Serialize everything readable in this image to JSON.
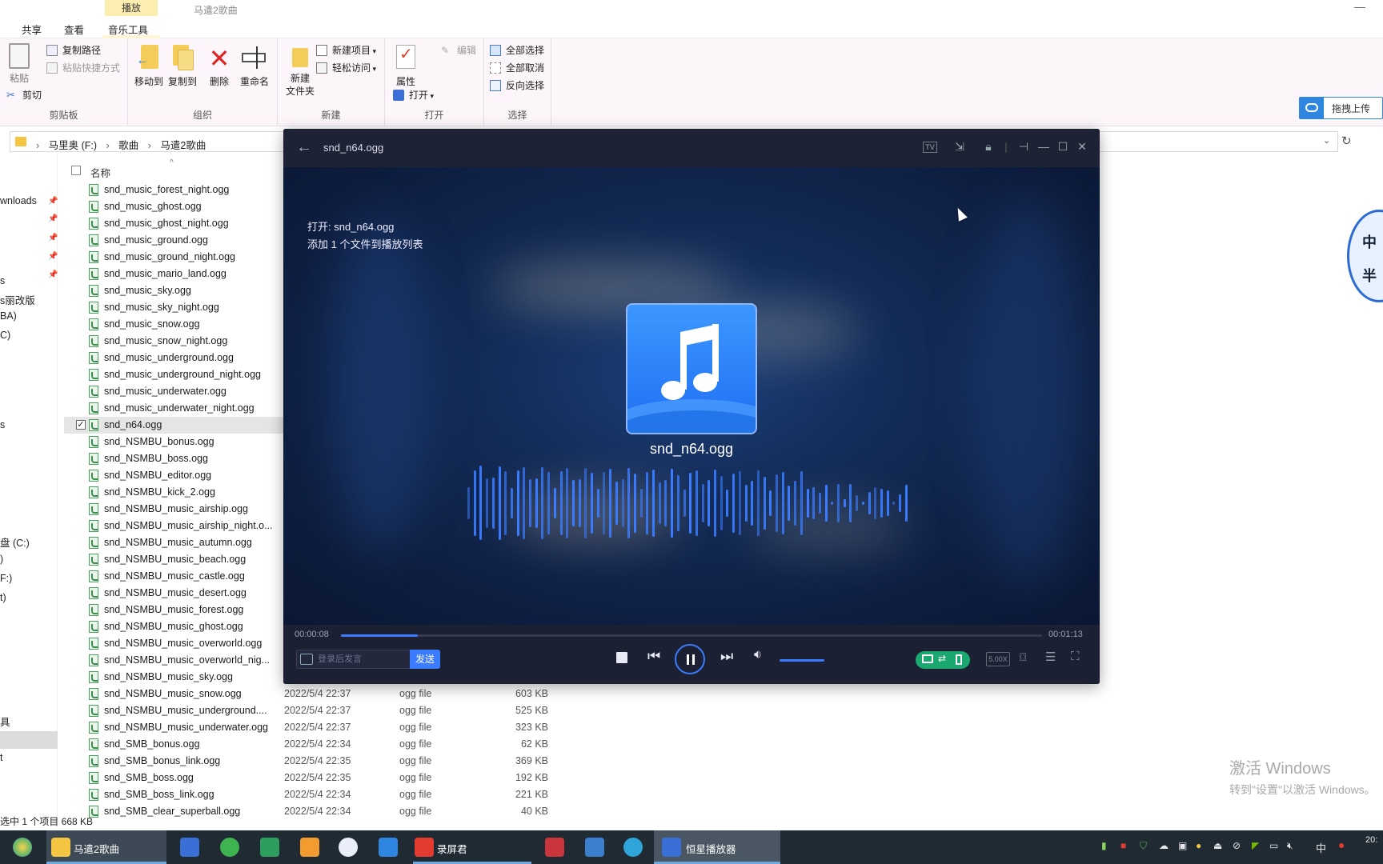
{
  "explorer": {
    "title": "马遣2歌曲",
    "context_tab": "播放",
    "tabs": [
      "共享",
      "查看",
      "音乐工具"
    ],
    "ribbon": {
      "clipboard": {
        "paste": "粘贴",
        "copy_path": "复制路径",
        "paste_shortcut": "粘贴快捷方式",
        "cut": "剪切",
        "label": "剪贴板"
      },
      "organize": {
        "move_to": "移动到",
        "copy_to": "复制到",
        "delete": "删除",
        "rename": "重命名",
        "label": "组织"
      },
      "new": {
        "new_folder_1": "新建",
        "new_folder_2": "文件夹",
        "new_item": "新建项目",
        "easy_access": "轻松访问",
        "label": "新建"
      },
      "open": {
        "properties": "属性",
        "open": "打开",
        "edit": "编辑",
        "label": "打开"
      },
      "select": {
        "select_all": "全部选择",
        "select_none": "全部取消",
        "invert": "反向选择",
        "label": "选择"
      },
      "upload": "拖拽上传"
    },
    "breadcrumb": [
      "马里奥 (F:)",
      "歌曲",
      "马遣2歌曲"
    ],
    "left_panel": [
      "wnloads",
      "s",
      "s丽改版",
      "BA)",
      "C)",
      "s",
      "盘 (C:)",
      ")",
      "F:)",
      "t)",
      "具",
      "t"
    ],
    "column_name": "名称",
    "files": [
      {
        "name": "snd_music_forest_night.ogg",
        "date": "",
        "type": "",
        "size": ""
      },
      {
        "name": "snd_music_ghost.ogg",
        "date": "",
        "type": "",
        "size": ""
      },
      {
        "name": "snd_music_ghost_night.ogg",
        "date": "",
        "type": "",
        "size": ""
      },
      {
        "name": "snd_music_ground.ogg",
        "date": "",
        "type": "",
        "size": ""
      },
      {
        "name": "snd_music_ground_night.ogg",
        "date": "",
        "type": "",
        "size": ""
      },
      {
        "name": "snd_music_mario_land.ogg",
        "date": "",
        "type": "",
        "size": ""
      },
      {
        "name": "snd_music_sky.ogg",
        "date": "",
        "type": "",
        "size": ""
      },
      {
        "name": "snd_music_sky_night.ogg",
        "date": "",
        "type": "",
        "size": ""
      },
      {
        "name": "snd_music_snow.ogg",
        "date": "",
        "type": "",
        "size": ""
      },
      {
        "name": "snd_music_snow_night.ogg",
        "date": "",
        "type": "",
        "size": ""
      },
      {
        "name": "snd_music_underground.ogg",
        "date": "",
        "type": "",
        "size": ""
      },
      {
        "name": "snd_music_underground_night.ogg",
        "date": "",
        "type": "",
        "size": ""
      },
      {
        "name": "snd_music_underwater.ogg",
        "date": "",
        "type": "",
        "size": ""
      },
      {
        "name": "snd_music_underwater_night.ogg",
        "date": "",
        "type": "",
        "size": ""
      },
      {
        "name": "snd_n64.ogg",
        "date": "",
        "type": "",
        "size": "",
        "selected": true
      },
      {
        "name": "snd_NSMBU_bonus.ogg",
        "date": "",
        "type": "",
        "size": ""
      },
      {
        "name": "snd_NSMBU_boss.ogg",
        "date": "",
        "type": "",
        "size": ""
      },
      {
        "name": "snd_NSMBU_editor.ogg",
        "date": "",
        "type": "",
        "size": ""
      },
      {
        "name": "snd_NSMBU_kick_2.ogg",
        "date": "",
        "type": "",
        "size": ""
      },
      {
        "name": "snd_NSMBU_music_airship.ogg",
        "date": "",
        "type": "",
        "size": ""
      },
      {
        "name": "snd_NSMBU_music_airship_night.o...",
        "date": "",
        "type": "",
        "size": ""
      },
      {
        "name": "snd_NSMBU_music_autumn.ogg",
        "date": "",
        "type": "",
        "size": ""
      },
      {
        "name": "snd_NSMBU_music_beach.ogg",
        "date": "",
        "type": "",
        "size": ""
      },
      {
        "name": "snd_NSMBU_music_castle.ogg",
        "date": "",
        "type": "",
        "size": ""
      },
      {
        "name": "snd_NSMBU_music_desert.ogg",
        "date": "",
        "type": "",
        "size": ""
      },
      {
        "name": "snd_NSMBU_music_forest.ogg",
        "date": "",
        "type": "",
        "size": ""
      },
      {
        "name": "snd_NSMBU_music_ghost.ogg",
        "date": "",
        "type": "",
        "size": ""
      },
      {
        "name": "snd_NSMBU_music_overworld.ogg",
        "date": "",
        "type": "",
        "size": ""
      },
      {
        "name": "snd_NSMBU_music_overworld_nig...",
        "date": "",
        "type": "",
        "size": ""
      },
      {
        "name": "snd_NSMBU_music_sky.ogg",
        "date": "",
        "type": "",
        "size": ""
      },
      {
        "name": "snd_NSMBU_music_snow.ogg",
        "date": "2022/5/4 22:37",
        "type": "ogg file",
        "size": "603 KB"
      },
      {
        "name": "snd_NSMBU_music_underground....",
        "date": "2022/5/4 22:37",
        "type": "ogg file",
        "size": "525 KB"
      },
      {
        "name": "snd_NSMBU_music_underwater.ogg",
        "date": "2022/5/4 22:37",
        "type": "ogg file",
        "size": "323 KB"
      },
      {
        "name": "snd_SMB_bonus.ogg",
        "date": "2022/5/4 22:34",
        "type": "ogg file",
        "size": "62 KB"
      },
      {
        "name": "snd_SMB_bonus_link.ogg",
        "date": "2022/5/4 22:35",
        "type": "ogg file",
        "size": "369 KB"
      },
      {
        "name": "snd_SMB_boss.ogg",
        "date": "2022/5/4 22:35",
        "type": "ogg file",
        "size": "192 KB"
      },
      {
        "name": "snd_SMB_boss_link.ogg",
        "date": "2022/5/4 22:34",
        "type": "ogg file",
        "size": "221 KB"
      },
      {
        "name": "snd_SMB_clear_superball.ogg",
        "date": "2022/5/4 22:34",
        "type": "ogg file",
        "size": "40 KB"
      }
    ],
    "status": "选中 1 个项目  668 KB"
  },
  "player": {
    "title": "snd_n64.ogg",
    "osd_line1": "打开: snd_n64.ogg",
    "osd_line2": "添加 1 个文件到播放列表",
    "track_name": "snd_n64.ogg",
    "time_current": "00:00:08",
    "time_total": "00:01:13",
    "progress": 0.11,
    "volume": 1.0,
    "danmaku_placeholder": "登录后发言",
    "send": "发送",
    "speed": "5.00X",
    "accent": "#3a7bff"
  },
  "watermark": {
    "line1": "激活 Windows",
    "line2": "转到\"设置\"以激活 Windows。"
  },
  "sticker": {
    "chars": [
      "中",
      "半"
    ]
  },
  "taskbar": {
    "items": [
      {
        "label": "马遣2歌曲"
      },
      {
        "label": "录屏君"
      },
      {
        "label": "恒星播放器"
      }
    ],
    "ime": "中",
    "clock_part": "20:"
  }
}
